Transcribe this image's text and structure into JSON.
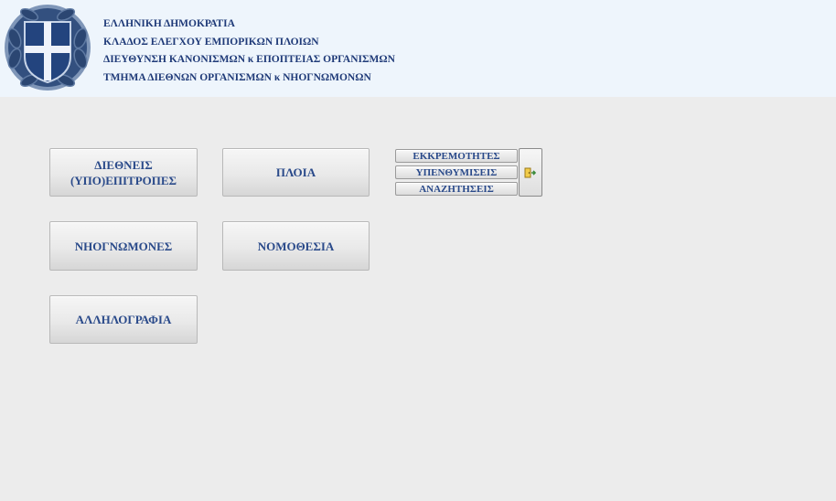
{
  "header": {
    "line1": "ΕΛΛΗΝΙΚΗ ΔΗΜΟΚΡΑΤΙΑ",
    "line2": "ΚΛΑΔΟΣ ΕΛΕΓΧΟΥ ΕΜΠΟΡΙΚΩΝ ΠΛΟΙΩΝ",
    "line3": "ΔΙΕΥΘΥΝΣΗ ΚΑΝΟΝΙΣΜΩΝ κ ΕΠΟΠΤΕΙΑΣ ΟΡΓΑΝΙΣΜΩΝ",
    "line4": "ΤΜΗΜΑ ΔΙΕΘΝΩΝ ΟΡΓΑΝΙΣΜΩΝ κ ΝΗΟΓΝΩΜΟΝΩΝ",
    "emblem_icon": "greek-coat-of-arms",
    "text_color": "#1f3a78",
    "background": "#eef5fc"
  },
  "menu": {
    "committees_line1": "ΔΙΕΘΝΕΙΣ",
    "committees_line2": "(ΥΠΟ)ΕΠΙΤΡΟΠΕΣ",
    "ships": "ΠΛΟΙΑ",
    "classification": "ΝΗΟΓΝΩΜΟΝΕΣ",
    "legislation": "ΝΟΜΟΘΕΣΙΑ",
    "correspondence": "ΑΛΛΗΛΟΓΡΑΦΙΑ"
  },
  "quick": {
    "pending": "ΕΚΚΡΕΜΟΤΗΤΕΣ",
    "reminders": "ΥΠΕΝΘΥΜΙΣΕΙΣ",
    "searches": "ΑΝΑΖΗΤΗΣΕΙΣ",
    "exit_icon": "exit-door-icon"
  },
  "colors": {
    "button_text": "#2a4a8a",
    "page_background": "#ececec"
  }
}
